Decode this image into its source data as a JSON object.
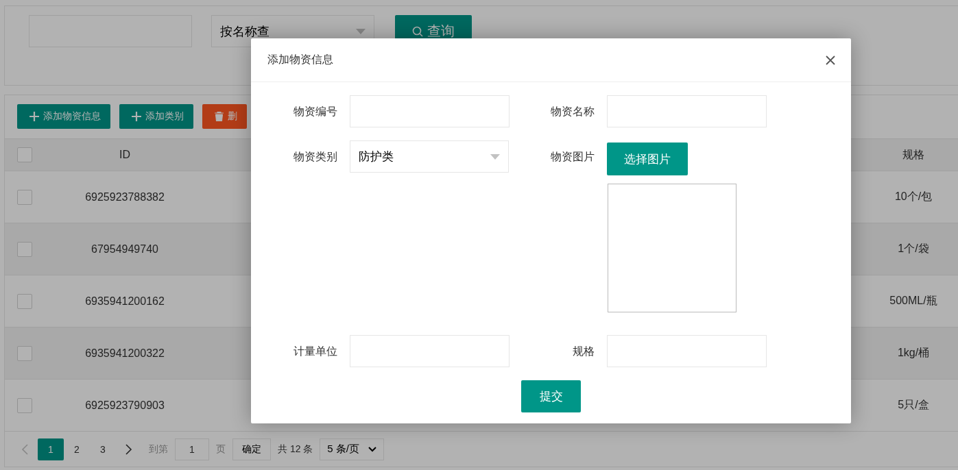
{
  "search": {
    "select_value": "按名称查",
    "button": "查询"
  },
  "toolbar": [
    {
      "kind": "add",
      "label": "添加物资信息"
    },
    {
      "kind": "add",
      "label": "添加类别"
    },
    {
      "kind": "delete",
      "label": "删"
    }
  ],
  "table": {
    "header_checkbox": {
      "checked": false
    },
    "columns": [
      "ID",
      "规格"
    ],
    "rows": [
      {
        "checked": false,
        "id": "6925923788382",
        "spec": "10个/包"
      },
      {
        "checked": false,
        "id": "67954949740",
        "spec": "1个/袋"
      },
      {
        "checked": false,
        "id": "6935941200162",
        "spec": "500ML/瓶"
      },
      {
        "checked": false,
        "id": "6935941200322",
        "spec": "1kg/桶"
      },
      {
        "checked": false,
        "id": "6925923790903",
        "spec": "5只/盒"
      }
    ]
  },
  "pagination": {
    "pages": [
      {
        "label": "1",
        "selected": true
      },
      {
        "label": "2",
        "selected": false
      },
      {
        "label": "3",
        "selected": false
      }
    ],
    "goto_label": "到第",
    "goto_value": "1",
    "page_unit": "页",
    "confirm": "确定",
    "total": "共 12 条",
    "page_size": "5 条/页"
  },
  "modal": {
    "title": "添加物资信息",
    "fields": [
      {
        "kind": "input",
        "label": "物资编号"
      },
      {
        "kind": "input",
        "label": "物资名称"
      },
      {
        "kind": "select",
        "label": "物资类别",
        "value": "防护类"
      },
      {
        "kind": "image",
        "label": "物资图片",
        "button": "选择图片"
      },
      {
        "kind": "input",
        "label": "计量单位"
      },
      {
        "kind": "input",
        "label": "规格"
      }
    ],
    "submit": "提交"
  }
}
